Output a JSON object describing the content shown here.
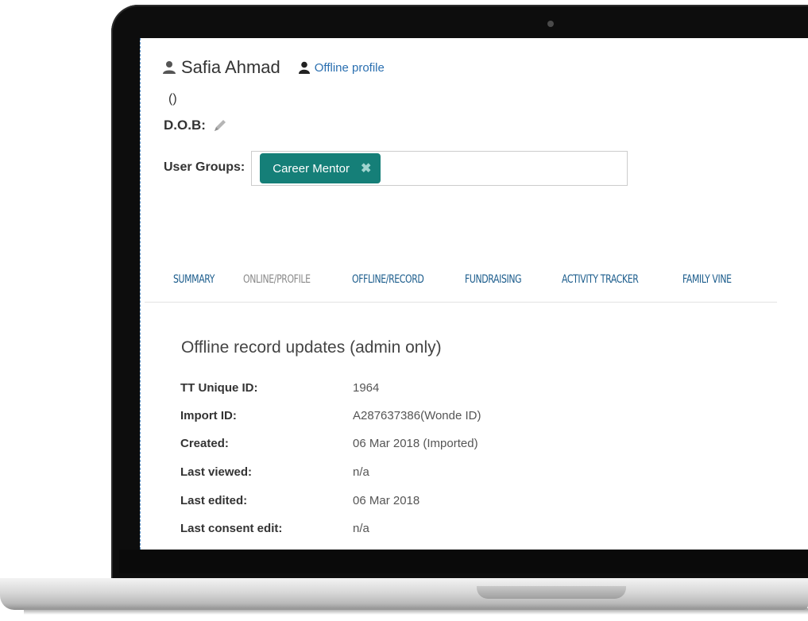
{
  "user": {
    "name": "Safia Ahmad",
    "profile_link": "Offline profile",
    "parens": "()",
    "dob_label": "D.O.B:"
  },
  "groups": {
    "label": "User Groups:",
    "tags": [
      {
        "label": "Career Mentor",
        "remove_icon": "✖"
      }
    ]
  },
  "tabs": [
    {
      "label": "SUMMARY",
      "active": true
    },
    {
      "label": "ONLINE/PROFILE",
      "active": false
    },
    {
      "label": "OFFLINE/RECORD",
      "active": true
    },
    {
      "label": "FUNDRAISING",
      "active": true
    },
    {
      "label": "ACTIVITY TRACKER",
      "active": true
    },
    {
      "label": "FAMILY VINE",
      "active": true
    }
  ],
  "section": {
    "title": "Offline record updates (admin only)",
    "rows": [
      {
        "key": "TT Unique ID:",
        "value": "1964"
      },
      {
        "key": "Import ID:",
        "value": "A287637386(Wonde ID)"
      },
      {
        "key": "Created:",
        "value": "06 Mar 2018 (Imported)"
      },
      {
        "key": "Last viewed:",
        "value": "n/a"
      },
      {
        "key": "Last edited:",
        "value": "06 Mar 2018"
      },
      {
        "key": "Last consent edit:",
        "value": "n/a"
      }
    ]
  },
  "colors": {
    "tag_bg": "#157f78",
    "link": "#2a6fb0",
    "tab_active": "#1b5c8c",
    "tab_inactive": "#8a8a8a"
  },
  "icons": {
    "user": "user-icon",
    "profile": "person-icon",
    "edit": "pencil-icon",
    "remove": "close-icon"
  }
}
